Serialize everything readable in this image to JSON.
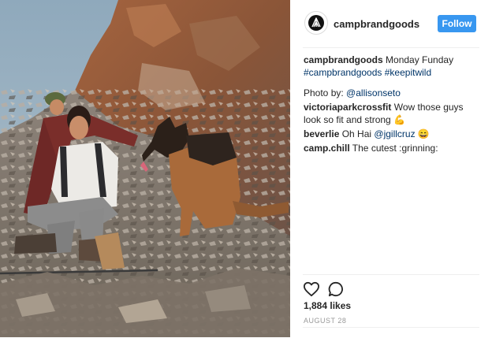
{
  "post": {
    "photo_alt": "Hikers and a German Shepherd dog resting on a rocky mountain slope",
    "author": {
      "username": "campbrandgoods",
      "avatar_icon": "tent-logo-icon"
    },
    "follow_label": "Follow",
    "caption": {
      "username": "campbrandgoods",
      "text": " Monday Funday ",
      "hashtags": [
        "#campbrandgoods",
        "#keepitwild"
      ]
    },
    "photo_credit": {
      "prefix": "Photo by: ",
      "mention": "@allisonseto"
    },
    "comments": [
      {
        "username": "victoriaparkcrossfit",
        "text": " Wow those guys look so fit and strong 💪"
      },
      {
        "username": "beverlie",
        "text": " Oh Hai ",
        "mention": "@jgillcruz",
        "suffix": " 😄"
      },
      {
        "username": "camp.chill",
        "text": " The cutest :grinning:"
      }
    ],
    "likes": "1,884 likes",
    "date": "AUGUST 28"
  },
  "icons": {
    "like": "heart-icon",
    "comment": "comment-bubble-icon"
  },
  "colors": {
    "follow_button": "#3897f0",
    "link": "#003569",
    "date_text": "#999999"
  }
}
